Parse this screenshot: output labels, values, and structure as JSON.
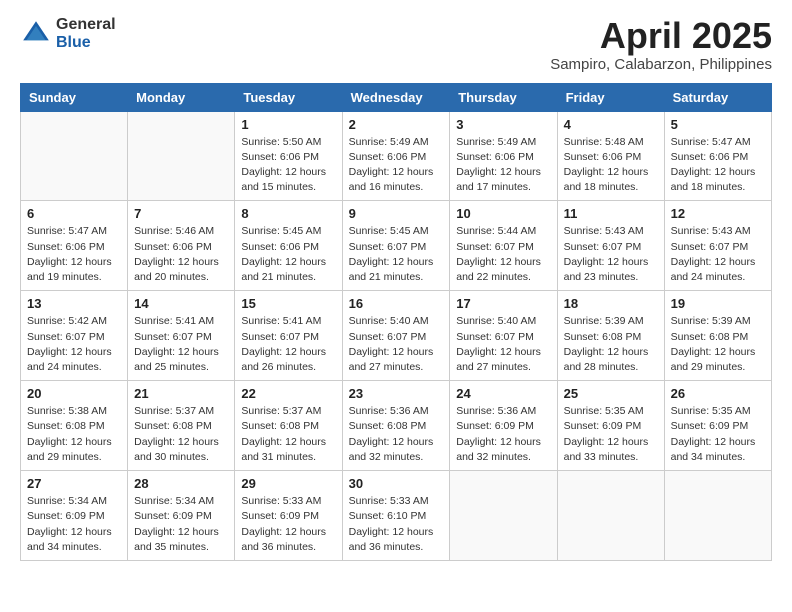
{
  "logo": {
    "general": "General",
    "blue": "Blue"
  },
  "title": "April 2025",
  "subtitle": "Sampiro, Calabarzon, Philippines",
  "days_header": [
    "Sunday",
    "Monday",
    "Tuesday",
    "Wednesday",
    "Thursday",
    "Friday",
    "Saturday"
  ],
  "weeks": [
    [
      {
        "day": "",
        "detail": ""
      },
      {
        "day": "",
        "detail": ""
      },
      {
        "day": "1",
        "detail": "Sunrise: 5:50 AM\nSunset: 6:06 PM\nDaylight: 12 hours and 15 minutes."
      },
      {
        "day": "2",
        "detail": "Sunrise: 5:49 AM\nSunset: 6:06 PM\nDaylight: 12 hours and 16 minutes."
      },
      {
        "day": "3",
        "detail": "Sunrise: 5:49 AM\nSunset: 6:06 PM\nDaylight: 12 hours and 17 minutes."
      },
      {
        "day": "4",
        "detail": "Sunrise: 5:48 AM\nSunset: 6:06 PM\nDaylight: 12 hours and 18 minutes."
      },
      {
        "day": "5",
        "detail": "Sunrise: 5:47 AM\nSunset: 6:06 PM\nDaylight: 12 hours and 18 minutes."
      }
    ],
    [
      {
        "day": "6",
        "detail": "Sunrise: 5:47 AM\nSunset: 6:06 PM\nDaylight: 12 hours and 19 minutes."
      },
      {
        "day": "7",
        "detail": "Sunrise: 5:46 AM\nSunset: 6:06 PM\nDaylight: 12 hours and 20 minutes."
      },
      {
        "day": "8",
        "detail": "Sunrise: 5:45 AM\nSunset: 6:06 PM\nDaylight: 12 hours and 21 minutes."
      },
      {
        "day": "9",
        "detail": "Sunrise: 5:45 AM\nSunset: 6:07 PM\nDaylight: 12 hours and 21 minutes."
      },
      {
        "day": "10",
        "detail": "Sunrise: 5:44 AM\nSunset: 6:07 PM\nDaylight: 12 hours and 22 minutes."
      },
      {
        "day": "11",
        "detail": "Sunrise: 5:43 AM\nSunset: 6:07 PM\nDaylight: 12 hours and 23 minutes."
      },
      {
        "day": "12",
        "detail": "Sunrise: 5:43 AM\nSunset: 6:07 PM\nDaylight: 12 hours and 24 minutes."
      }
    ],
    [
      {
        "day": "13",
        "detail": "Sunrise: 5:42 AM\nSunset: 6:07 PM\nDaylight: 12 hours and 24 minutes."
      },
      {
        "day": "14",
        "detail": "Sunrise: 5:41 AM\nSunset: 6:07 PM\nDaylight: 12 hours and 25 minutes."
      },
      {
        "day": "15",
        "detail": "Sunrise: 5:41 AM\nSunset: 6:07 PM\nDaylight: 12 hours and 26 minutes."
      },
      {
        "day": "16",
        "detail": "Sunrise: 5:40 AM\nSunset: 6:07 PM\nDaylight: 12 hours and 27 minutes."
      },
      {
        "day": "17",
        "detail": "Sunrise: 5:40 AM\nSunset: 6:07 PM\nDaylight: 12 hours and 27 minutes."
      },
      {
        "day": "18",
        "detail": "Sunrise: 5:39 AM\nSunset: 6:08 PM\nDaylight: 12 hours and 28 minutes."
      },
      {
        "day": "19",
        "detail": "Sunrise: 5:39 AM\nSunset: 6:08 PM\nDaylight: 12 hours and 29 minutes."
      }
    ],
    [
      {
        "day": "20",
        "detail": "Sunrise: 5:38 AM\nSunset: 6:08 PM\nDaylight: 12 hours and 29 minutes."
      },
      {
        "day": "21",
        "detail": "Sunrise: 5:37 AM\nSunset: 6:08 PM\nDaylight: 12 hours and 30 minutes."
      },
      {
        "day": "22",
        "detail": "Sunrise: 5:37 AM\nSunset: 6:08 PM\nDaylight: 12 hours and 31 minutes."
      },
      {
        "day": "23",
        "detail": "Sunrise: 5:36 AM\nSunset: 6:08 PM\nDaylight: 12 hours and 32 minutes."
      },
      {
        "day": "24",
        "detail": "Sunrise: 5:36 AM\nSunset: 6:09 PM\nDaylight: 12 hours and 32 minutes."
      },
      {
        "day": "25",
        "detail": "Sunrise: 5:35 AM\nSunset: 6:09 PM\nDaylight: 12 hours and 33 minutes."
      },
      {
        "day": "26",
        "detail": "Sunrise: 5:35 AM\nSunset: 6:09 PM\nDaylight: 12 hours and 34 minutes."
      }
    ],
    [
      {
        "day": "27",
        "detail": "Sunrise: 5:34 AM\nSunset: 6:09 PM\nDaylight: 12 hours and 34 minutes."
      },
      {
        "day": "28",
        "detail": "Sunrise: 5:34 AM\nSunset: 6:09 PM\nDaylight: 12 hours and 35 minutes."
      },
      {
        "day": "29",
        "detail": "Sunrise: 5:33 AM\nSunset: 6:09 PM\nDaylight: 12 hours and 36 minutes."
      },
      {
        "day": "30",
        "detail": "Sunrise: 5:33 AM\nSunset: 6:10 PM\nDaylight: 12 hours and 36 minutes."
      },
      {
        "day": "",
        "detail": ""
      },
      {
        "day": "",
        "detail": ""
      },
      {
        "day": "",
        "detail": ""
      }
    ]
  ]
}
